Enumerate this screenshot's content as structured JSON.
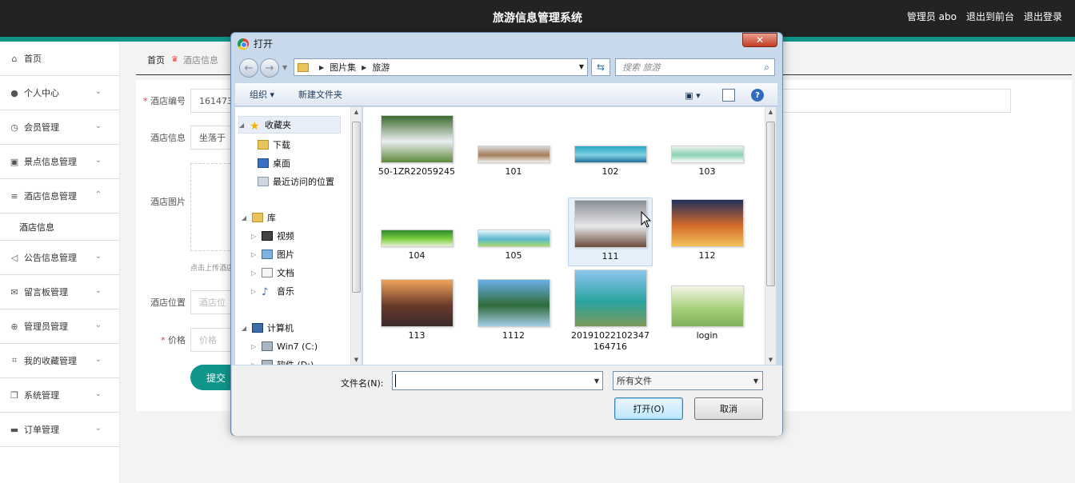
{
  "header": {
    "title": "旅游信息管理系统",
    "user": "管理员 abo",
    "back_front": "退出到前台",
    "logout": "退出登录"
  },
  "sidebar": {
    "items": [
      {
        "label": "首页",
        "icon": "home-icon"
      },
      {
        "label": "个人中心",
        "icon": "user-icon"
      },
      {
        "label": "会员管理",
        "icon": "clock-icon"
      },
      {
        "label": "景点信息管理",
        "icon": "clipboard-icon"
      },
      {
        "label": "酒店信息管理",
        "icon": "list-icon"
      },
      {
        "label": "公告信息管理",
        "icon": "send-icon"
      },
      {
        "label": "留言板管理",
        "icon": "mail-icon"
      },
      {
        "label": "管理员管理",
        "icon": "compass-icon"
      },
      {
        "label": "我的收藏管理",
        "icon": "crop-icon"
      },
      {
        "label": "系统管理",
        "icon": "copy-icon"
      },
      {
        "label": "订单管理",
        "icon": "monitor-icon"
      }
    ],
    "sub_item": "酒店信息"
  },
  "breadcrumb": {
    "home": "首页",
    "current": "酒店信息"
  },
  "form": {
    "hotel_no_label": "酒店编号",
    "hotel_no_value": "161473",
    "hotel_info_label": "酒店信息",
    "hotel_info_value": "坐落于",
    "hotel_img_label": "酒店图片",
    "upload_tip": "点击上传酒店",
    "location_label": "酒店位置",
    "location_placeholder": "酒店位",
    "price_label": "价格",
    "price_placeholder": "价格",
    "submit": "提交"
  },
  "dialog": {
    "title": "打开",
    "path": [
      "图片集",
      "旅游"
    ],
    "search_placeholder": "搜索 旅游",
    "organize": "组织",
    "new_folder": "新建文件夹",
    "tree": [
      {
        "label": "收藏夹",
        "icon": "star-icon",
        "group": true
      },
      {
        "label": "下载",
        "icon": "download-folder-icon"
      },
      {
        "label": "桌面",
        "icon": "desktop-icon"
      },
      {
        "label": "最近访问的位置",
        "icon": "recent-places-icon"
      },
      {
        "label": "库",
        "icon": "library-icon",
        "group": true
      },
      {
        "label": "视频",
        "icon": "video-icon"
      },
      {
        "label": "图片",
        "icon": "pictures-icon"
      },
      {
        "label": "文档",
        "icon": "documents-icon"
      },
      {
        "label": "音乐",
        "icon": "music-icon"
      },
      {
        "label": "计算机",
        "icon": "computer-icon",
        "group": true
      },
      {
        "label": "Win7 (C:)",
        "icon": "drive-icon"
      },
      {
        "label": "软件 (D:)",
        "icon": "drive-icon"
      }
    ],
    "files": [
      {
        "name": "50-1ZR22059245",
        "colors": [
          "#3d6b2e",
          "#e9eef0",
          "#5f8a3a"
        ]
      },
      {
        "name": "101",
        "colors": [
          "#d9d9d9",
          "#a37d58",
          "#f2f2f2"
        ]
      },
      {
        "name": "102",
        "colors": [
          "#2aa6c6",
          "#7fd1e0",
          "#1f6c9e"
        ]
      },
      {
        "name": "103",
        "colors": [
          "#e8f4ee",
          "#8ad1b1",
          "#ffffff"
        ]
      },
      {
        "name": "104",
        "colors": [
          "#2e8b2e",
          "#7fcf3f",
          "#e6f1d8"
        ]
      },
      {
        "name": "105",
        "colors": [
          "#e8f7fa",
          "#5bb7cf",
          "#a6d96a"
        ]
      },
      {
        "name": "111",
        "colors": [
          "#8a8e96",
          "#e8e8ea",
          "#6a4a3a"
        ]
      },
      {
        "name": "112",
        "colors": [
          "#1f2f5c",
          "#d56b2a",
          "#f3c25a"
        ]
      },
      {
        "name": "113",
        "colors": [
          "#f0a45a",
          "#6a3a2a",
          "#3a2a2a"
        ]
      },
      {
        "name": "1112",
        "colors": [
          "#6ab0e8",
          "#2f6a3a",
          "#a3cde8"
        ]
      },
      {
        "name": "20191022102347164716",
        "colors": [
          "#8ec7ef",
          "#2aa3a0",
          "#7a9a5a"
        ]
      },
      {
        "name": "login",
        "colors": [
          "#f5f5e8",
          "#a6d07a",
          "#7fb05a"
        ]
      }
    ],
    "filename_label": "文件名(N):",
    "filename_value": "",
    "filter": "所有文件",
    "open_btn": "打开(O)",
    "cancel_btn": "取消"
  }
}
